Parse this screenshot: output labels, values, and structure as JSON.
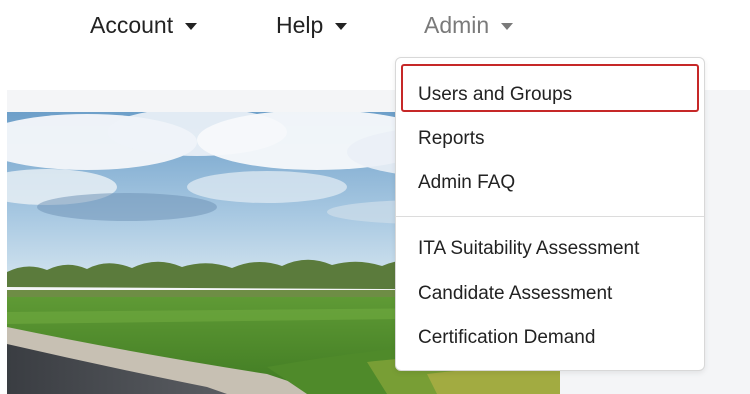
{
  "navbar": {
    "items": [
      {
        "label": "Account"
      },
      {
        "label": "Help"
      },
      {
        "label": "Admin"
      }
    ]
  },
  "admin_menu": {
    "items": [
      {
        "label": "Users and Groups"
      },
      {
        "label": "Reports"
      },
      {
        "label": "Admin FAQ"
      },
      {
        "label": "ITA Suitability Assessment"
      },
      {
        "label": "Candidate Assessment"
      },
      {
        "label": "Certification Demand"
      }
    ]
  },
  "colors": {
    "highlight": "#c62828",
    "text": "#222222",
    "active_nav": "#7a7a7a"
  }
}
